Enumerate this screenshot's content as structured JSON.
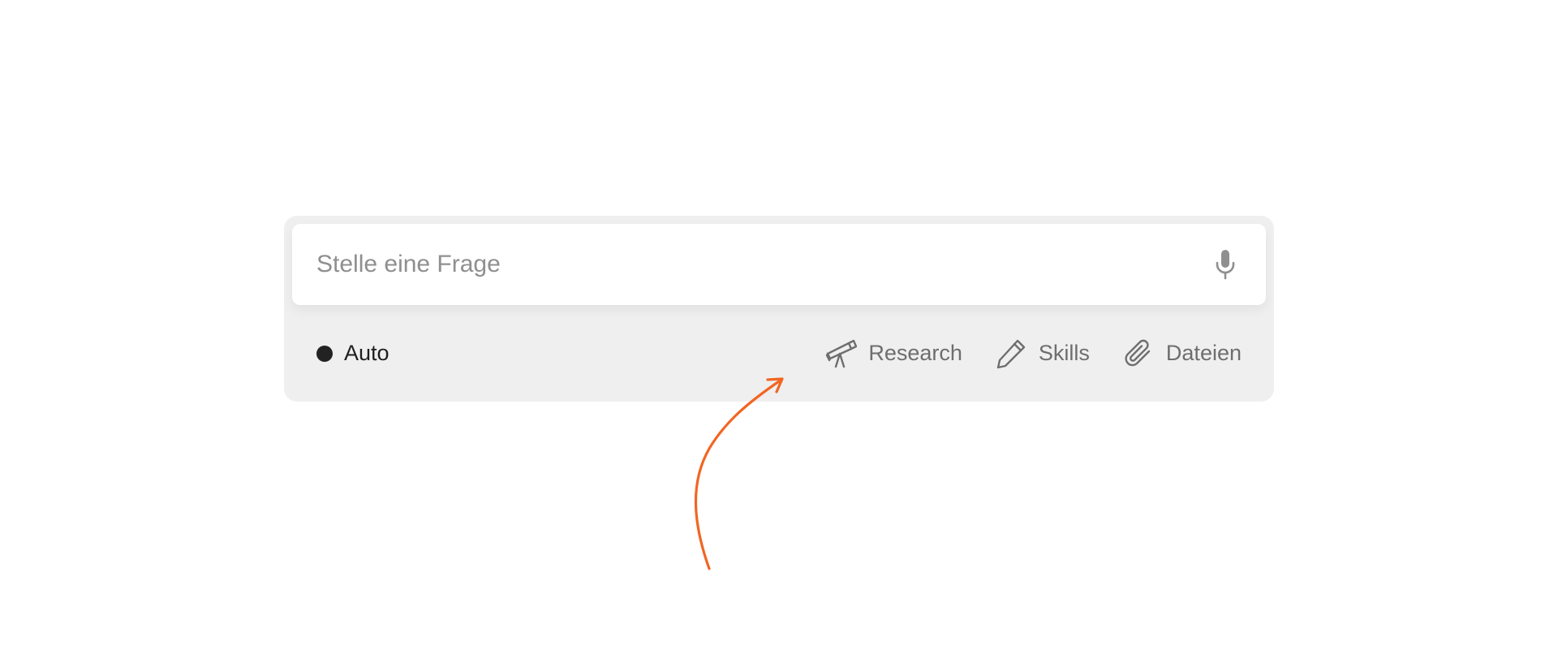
{
  "composer": {
    "input": {
      "placeholder": "Stelle eine Frage",
      "value": ""
    },
    "mic_icon": "microphone-icon",
    "mode": {
      "label": "Auto",
      "dot_color": "#222222"
    },
    "actions": [
      {
        "label": "Research",
        "icon": "telescope-icon"
      },
      {
        "label": "Skills",
        "icon": "pencil-icon"
      },
      {
        "label": "Dateien",
        "icon": "paperclip-icon"
      }
    ]
  },
  "annotation": {
    "arrow_color": "#f26522"
  }
}
